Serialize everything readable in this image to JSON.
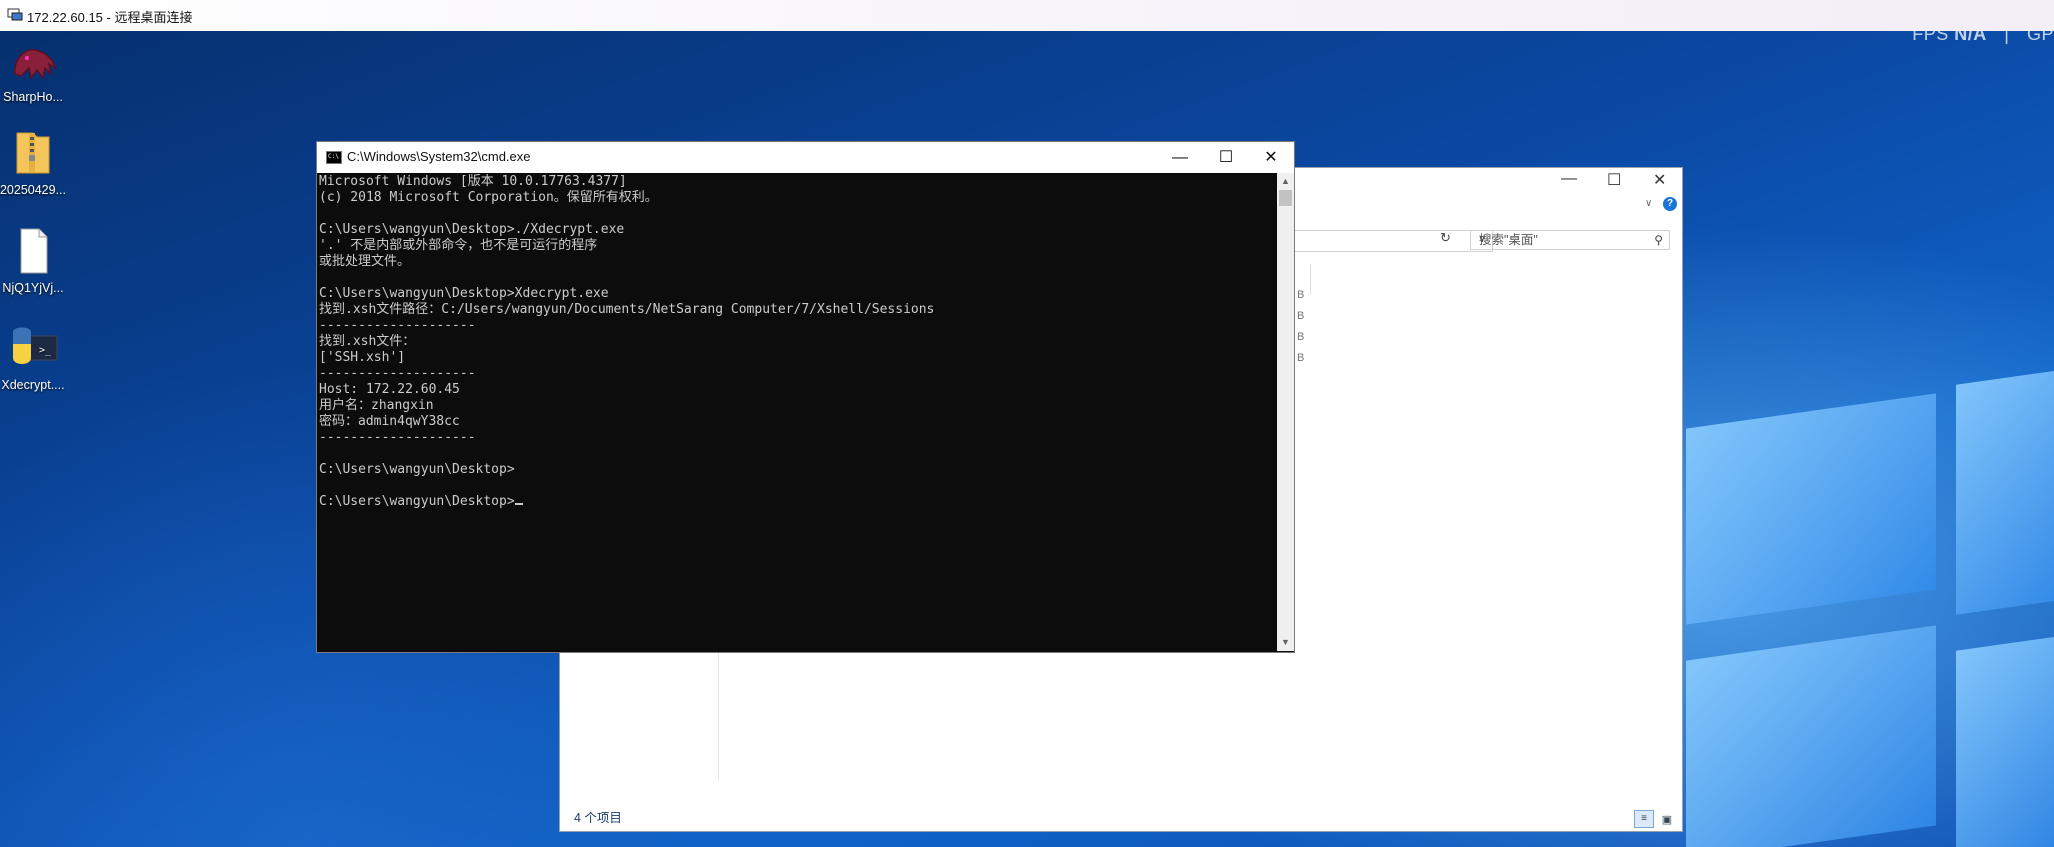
{
  "rdp": {
    "title": "172.22.60.15 - 远程桌面连接"
  },
  "overlay": {
    "fps_label": "FPS",
    "fps_value": "N/A",
    "separator": "|",
    "gpu_label": "GP"
  },
  "desktop": {
    "icons": [
      {
        "label": "SharpHo...",
        "icon": "dragon-app-icon"
      },
      {
        "label": "20250429...",
        "icon": "zip-folder-icon"
      },
      {
        "label": "NjQ1YjVj...",
        "icon": "blank-file-icon"
      },
      {
        "label": "Xdecrypt....",
        "icon": "python-exe-icon"
      }
    ]
  },
  "explorer": {
    "search_placeholder": "搜索\"桌面\"",
    "status": "4 个项目",
    "size_col": [
      "B",
      "B",
      "B",
      "B"
    ]
  },
  "cmd": {
    "title": "C:\\Windows\\System32\\cmd.exe",
    "lines": [
      "Microsoft Windows [版本 10.0.17763.4377]",
      "(c) 2018 Microsoft Corporation。保留所有权利。",
      "",
      "C:\\Users\\wangyun\\Desktop>./Xdecrypt.exe",
      "'.' 不是内部或外部命令，也不是可运行的程序",
      "或批处理文件。",
      "",
      "C:\\Users\\wangyun\\Desktop>Xdecrypt.exe",
      "找到.xsh文件路径：C:/Users/wangyun/Documents/NetSarang Computer/7/Xshell/Sessions",
      "--------------------",
      "找到.xsh文件：",
      "['SSH.xsh']",
      "--------------------",
      "Host: 172.22.60.45",
      "用户名：zhangxin",
      "密码：admin4qwY38cc",
      "--------------------",
      "",
      "C:\\Users\\wangyun\\Desktop>",
      "",
      "C:\\Users\\wangyun\\Desktop>"
    ]
  }
}
